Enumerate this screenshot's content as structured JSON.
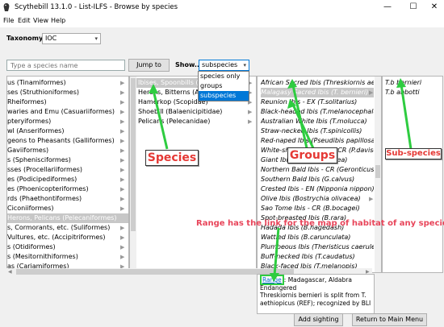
{
  "window": {
    "title": "Scythebill 13.1.0 - List-ILFS - Browse by species",
    "buttons": {
      "minimize": "—",
      "maximize": "☐",
      "close": "✕"
    }
  },
  "menu": [
    "File",
    "Edit",
    "View",
    "Help"
  ],
  "taxonomy": {
    "label": "Taxonomy:",
    "value": "IOC"
  },
  "search": {
    "placeholder": "Type a species name"
  },
  "jump_label": "Jump to",
  "show": {
    "label": "Show...",
    "value": "subspecies",
    "options": [
      "species only",
      "groups",
      "subspecies"
    ]
  },
  "orders": [
    "us (Tinamiformes)",
    "ses (Struthioniformes)",
    "Rheiformes)",
    "waries and Emu (Casuariiformes)",
    "pteryiformes)",
    "wl (Anseriformes)",
    "geons to Pheasants (Galliformes)",
    "Gaviiformes)",
    "s (Sphenisciformes)",
    "sses (Procellariiformes)",
    "es (Podicipediformes)",
    "es (Phoenicopteriformes)",
    "rds (Phaethontiformes)",
    "Ciconiiformes)",
    "Herons, Pelicans (Pelecaniformes)",
    "s, Cormorants, etc. (Suliformes)",
    "Vultures, etc. (Accipitriformes)",
    "s (Otidiformes)",
    "s (Mesitornithiformes)",
    "as (Cariamiformes)"
  ],
  "families": [
    "Ibises, Spoonbills (Threskiornithidae)",
    "Herons, Bitterns (Ardeidae)",
    "Hamerkop (Scopidae)",
    "Shoebill (Balaenicipitidae)",
    "Pelicans (Pelecanidae)"
  ],
  "species": [
    "African Sacred Ibis (Threskiornis aethiopicus)",
    "Malagasy Sacred Ibis (T. bernieri)",
    "Reunion Ibis - EX (T.solitarius)",
    "Black-headed Ibis (T.melanocephalus)",
    "Australian White Ibis (T.molucca)",
    "Straw-necked Ibis (T.spinicollis)",
    "Red-naped Ibis (Pseudibis papillosa)",
    "White-shouldered Ibis - CR (P.davisoni)",
    "Giant Ibis - CR (P.gigantea)",
    "Northern Bald Ibis - CR (Geronticus eremita)",
    "Southern Bald Ibis (G.calvus)",
    "Crested Ibis - EN (Nipponia nippon)",
    "Olive Ibis (Bostrychia olivacea)",
    "Sao Tome Ibis - CR (B.bocagei)",
    "Spot-breasted Ibis (B.rara)",
    "Hadada Ibis (B.hagedash)",
    "Wattled Ibis (B.carunculata)",
    "Plumbeous Ibis (Theristicus caerulescens)",
    "Buff-necked Ibis (T.caudatus)",
    "Black-faced Ibis (T.melanopis)"
  ],
  "subspecies": [
    "T.b bernieri",
    "T.b abbotti"
  ],
  "info": {
    "range_link": "Range",
    "range_text": ": Madagascar, Aldabra",
    "status": "Endangered",
    "note": "Threskiornis bernieri is split from T. aethiopicus (REF); recognized by BLI"
  },
  "footer": {
    "add_sighting": "Add sighting",
    "return_main": "Return to Main Menu"
  },
  "annotations": {
    "species": "Species",
    "groups": "Groups",
    "subspecies": "Sub-species",
    "range_note": "Range has the link for the map of habitat of any species"
  },
  "colors": {
    "annotation_red": "#e53935",
    "arrow_green": "#2ecc40",
    "selection_blue": "#0078d7",
    "link_blue": "#0066cc"
  }
}
